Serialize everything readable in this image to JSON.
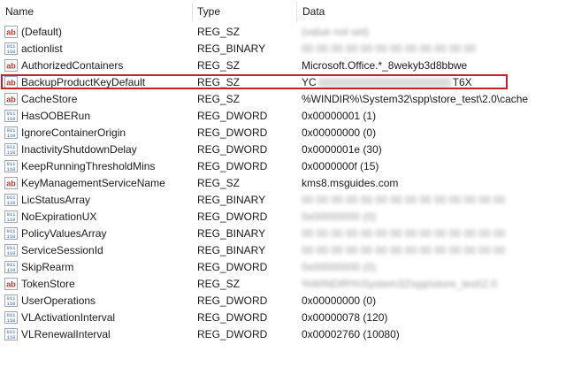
{
  "columns": {
    "name": "Name",
    "type": "Type",
    "data": "Data"
  },
  "rows": [
    {
      "name": "(Default)",
      "type": "REG_SZ",
      "data": "(value not set)",
      "icon": "string-value-icon",
      "blurred": true
    },
    {
      "name": "actionlist",
      "type": "REG_BINARY",
      "data": "00 00 00 00 00 00 00 00 00 00 00 00",
      "icon": "binary-value-icon",
      "blurred": true
    },
    {
      "name": "AuthorizedContainers",
      "type": "REG_SZ",
      "data": "Microsoft.Office.*_8wekyb3d8bbwe",
      "icon": "string-value-icon",
      "blurred": false
    },
    {
      "name": "BackupProductKeyDefault",
      "type": "REG_SZ",
      "data_prefix": "YC",
      "data_suffix": "T6X",
      "icon": "string-value-icon",
      "blurred": false,
      "highlighted": true
    },
    {
      "name": "CacheStore",
      "type": "REG_SZ",
      "data": "%WINDIR%\\System32\\spp\\store_test\\2.0\\cache",
      "icon": "string-value-icon",
      "blurred": false
    },
    {
      "name": "HasOOBERun",
      "type": "REG_DWORD",
      "data": "0x00000001 (1)",
      "icon": "binary-value-icon",
      "blurred": false
    },
    {
      "name": "IgnoreContainerOrigin",
      "type": "REG_DWORD",
      "data": "0x00000000 (0)",
      "icon": "binary-value-icon",
      "blurred": false
    },
    {
      "name": "InactivityShutdownDelay",
      "type": "REG_DWORD",
      "data": "0x0000001e (30)",
      "icon": "binary-value-icon",
      "blurred": false
    },
    {
      "name": "KeepRunningThresholdMins",
      "type": "REG_DWORD",
      "data": "0x0000000f (15)",
      "icon": "binary-value-icon",
      "blurred": false
    },
    {
      "name": "KeyManagementServiceName",
      "type": "REG_SZ",
      "data": "kms8.msguides.com",
      "icon": "string-value-icon",
      "blurred": false
    },
    {
      "name": "LicStatusArray",
      "type": "REG_BINARY",
      "data": "00 00 00 00 00 00 00 00 00 00 00 00 00 00",
      "icon": "binary-value-icon",
      "blurred": true
    },
    {
      "name": "NoExpirationUX",
      "type": "REG_DWORD",
      "data": "0x00000000 (0)",
      "icon": "binary-value-icon",
      "blurred": true
    },
    {
      "name": "PolicyValuesArray",
      "type": "REG_BINARY",
      "data": "00 00 00 00 00 00 00 00 00 00 00 00 00 00",
      "icon": "binary-value-icon",
      "blurred": true
    },
    {
      "name": "ServiceSessionId",
      "type": "REG_BINARY",
      "data": "00 00 00 00 00 00 00 00 00 00 00 00 00 00",
      "icon": "binary-value-icon",
      "blurred": true
    },
    {
      "name": "SkipRearm",
      "type": "REG_DWORD",
      "data": "0x00000000 (0)",
      "icon": "binary-value-icon",
      "blurred": true
    },
    {
      "name": "TokenStore",
      "type": "REG_SZ",
      "data": "%WINDIR%\\System32\\spp\\store_test\\2.0",
      "icon": "string-value-icon",
      "blurred": true
    },
    {
      "name": "UserOperations",
      "type": "REG_DWORD",
      "data": "0x00000000 (0)",
      "icon": "binary-value-icon",
      "blurred": false
    },
    {
      "name": "VLActivationInterval",
      "type": "REG_DWORD",
      "data": "0x00000078 (120)",
      "icon": "binary-value-icon",
      "blurred": false
    },
    {
      "name": "VLRenewalInterval",
      "type": "REG_DWORD",
      "data": "0x00002760 (10080)",
      "icon": "binary-value-icon",
      "blurred": false
    }
  ],
  "colors": {
    "highlight": "#c8202c",
    "string_icon": "#c0392b",
    "binary_icon": "#1f5fbf"
  }
}
